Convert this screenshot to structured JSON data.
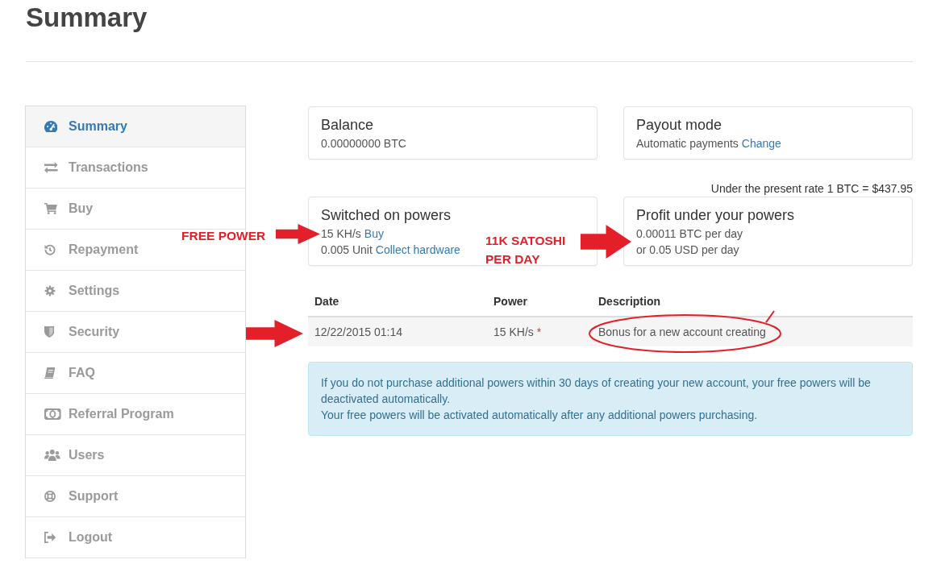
{
  "page": {
    "title": "Summary"
  },
  "sidebar": {
    "items": [
      {
        "label": "Summary",
        "selected": true
      },
      {
        "label": "Transactions",
        "selected": false
      },
      {
        "label": "Buy",
        "selected": false
      },
      {
        "label": "Repayment",
        "selected": false
      },
      {
        "label": "Settings",
        "selected": false
      },
      {
        "label": "Security",
        "selected": false
      },
      {
        "label": "FAQ",
        "selected": false
      },
      {
        "label": "Referral Program",
        "selected": false
      },
      {
        "label": "Users",
        "selected": false
      },
      {
        "label": "Support",
        "selected": false
      },
      {
        "label": "Logout",
        "selected": false
      }
    ]
  },
  "top_cards": [
    {
      "title": "Balance",
      "lines": [
        {
          "text": "0.00000000 BTC"
        }
      ]
    },
    {
      "title": "Payout mode",
      "lines": [
        {
          "text": "Automatic payments",
          "link": "Change"
        }
      ]
    }
  ],
  "rate_note": "Under the present rate 1 BTC = $437.95",
  "bottom_cards": [
    {
      "title": "Switched on powers",
      "lines": [
        {
          "text": "15 KH/s",
          "link": "Buy"
        },
        {
          "text": "0.005 Unit",
          "link": "Collect hardware"
        }
      ]
    },
    {
      "title": "Profit under your powers",
      "lines": [
        {
          "text": "0.00011 BTC per day"
        },
        {
          "text": "or 0.05 USD per day"
        }
      ]
    }
  ],
  "table": {
    "columns": [
      "Date",
      "Power",
      "Description"
    ],
    "rows": [
      {
        "cells": [
          {
            "text": "12/22/2015 01:14"
          },
          {
            "text": "15 KH/s",
            "mark": "*"
          },
          {
            "text": "Bonus for a new account creating"
          }
        ]
      }
    ]
  },
  "alert": {
    "paragraphs": [
      "If you do not purchase additional powers within 30 days of creating your new account, your free powers will be deactivated automatically.",
      "Your free powers will be activated automatically after any additional powers purchasing."
    ]
  },
  "annotations": [
    {
      "kind": "label",
      "text": "FREE POWER"
    },
    {
      "kind": "arrow"
    },
    {
      "kind": "label",
      "text": "11K SATOSHI PER DAY"
    },
    {
      "kind": "arrow"
    },
    {
      "kind": "arrow"
    },
    {
      "kind": "ellipse"
    }
  ]
}
